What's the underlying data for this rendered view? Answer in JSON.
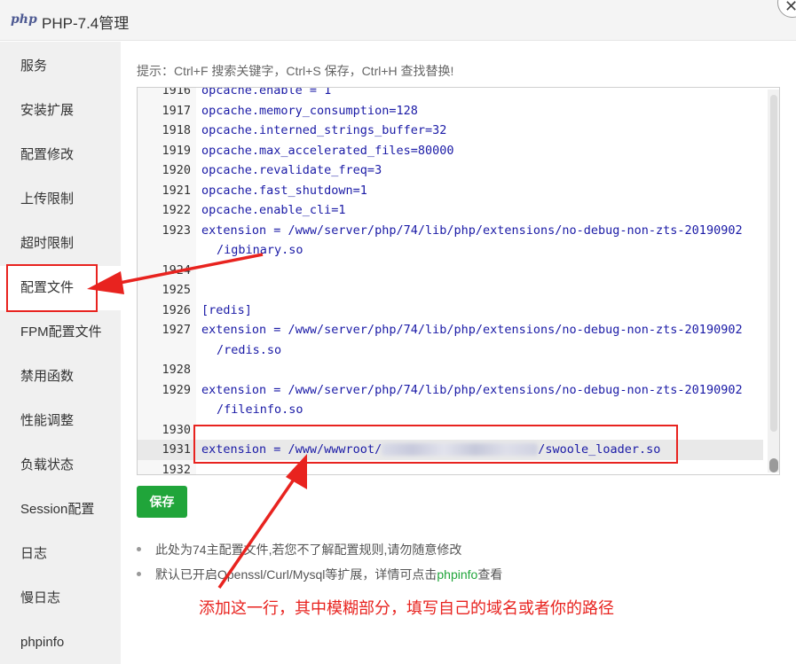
{
  "window": {
    "logo": "php",
    "title": "PHP-7.4管理",
    "close_glyph": "✕"
  },
  "sidebar": {
    "items": [
      {
        "label": "服务"
      },
      {
        "label": "安装扩展"
      },
      {
        "label": "配置修改"
      },
      {
        "label": "上传限制"
      },
      {
        "label": "超时限制"
      },
      {
        "label": "配置文件",
        "active": true
      },
      {
        "label": "FPM配置文件"
      },
      {
        "label": "禁用函数"
      },
      {
        "label": "性能调整"
      },
      {
        "label": "负载状态"
      },
      {
        "label": "Session配置"
      },
      {
        "label": "日志"
      },
      {
        "label": "慢日志"
      },
      {
        "label": "phpinfo"
      }
    ]
  },
  "hint": "提示：Ctrl+F 搜索关键字，Ctrl+S 保存，Ctrl+H 查找替换!",
  "editor": {
    "lines": [
      {
        "n": "1916",
        "t": "opcache.enable = 1"
      },
      {
        "n": "1917",
        "t": "opcache.memory_consumption=128"
      },
      {
        "n": "1918",
        "t": "opcache.interned_strings_buffer=32"
      },
      {
        "n": "1919",
        "t": "opcache.max_accelerated_files=80000"
      },
      {
        "n": "1920",
        "t": "opcache.revalidate_freq=3"
      },
      {
        "n": "1921",
        "t": "opcache.fast_shutdown=1"
      },
      {
        "n": "1922",
        "t": "opcache.enable_cli=1"
      },
      {
        "n": "1923",
        "t": "extension = /www/server/php/74/lib/php/extensions/no-debug-non-zts-20190902",
        "w": "/igbinary.so"
      },
      {
        "n": "1924",
        "t": ""
      },
      {
        "n": "1925",
        "t": ""
      },
      {
        "n": "1926",
        "t": "[redis]"
      },
      {
        "n": "1927",
        "t": "extension = /www/server/php/74/lib/php/extensions/no-debug-non-zts-20190902",
        "w": "/redis.so"
      },
      {
        "n": "1928",
        "t": ""
      },
      {
        "n": "1929",
        "t": "extension = /www/server/php/74/lib/php/extensions/no-debug-non-zts-20190902",
        "w": "/fileinfo.so"
      },
      {
        "n": "1930",
        "t": ""
      },
      {
        "n": "1931",
        "t_before": "extension = /www/wwwroot/",
        "t_after": "/swoole_loader.so",
        "highlight": true
      },
      {
        "n": "1932",
        "t": ""
      }
    ]
  },
  "save_label": "保存",
  "notes": [
    {
      "text": "此处为74主配置文件,若您不了解配置规则,请勿随意修改"
    },
    {
      "before": "默认已开启Openssl/Curl/Mysql等扩展，详情可点击",
      "link": "phpinfo",
      "after": "查看"
    }
  ],
  "callout": "添加这一行，其中模糊部分，填写自己的域名或者你的路径",
  "colors": {
    "accent": "#20a53a",
    "annotation": "#e8231f",
    "code": "#1a1aa6"
  }
}
